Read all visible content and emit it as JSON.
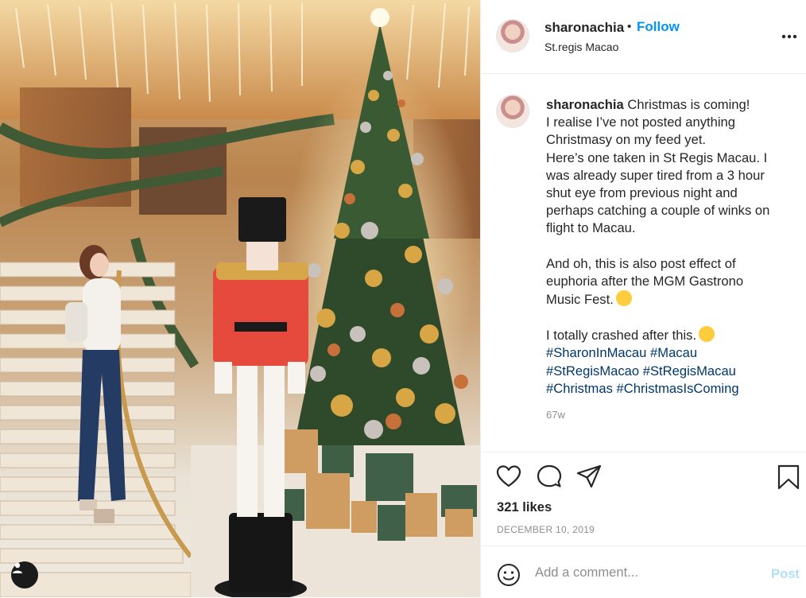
{
  "post": {
    "username": "sharonachia",
    "separator": "•",
    "follow_label": "Follow",
    "location": "St.regis Macao",
    "more_icon": "more-options-icon"
  },
  "caption": {
    "username": "sharonachia",
    "lines": [
      "Christmas is coming!",
      "I realise I’ve not posted anything",
      "Christmasy on my feed yet.",
      "Here’s one taken in St Regis Macau. I",
      "was already super tired from a 3 hour",
      "shut eye from previous night and",
      "perhaps catching a couple of winks on",
      "flight to Macau.",
      "And oh, this is also post effect of",
      "euphoria after the MGM Gastrono",
      "Music Fest.",
      "I totally crashed after this."
    ],
    "hashtags": [
      "#SharonInMacau",
      "#Macau",
      "#StRegisMacao",
      "#StRegisMacau",
      "#Christmas",
      "#ChristmasIsComing"
    ],
    "time_ago": "67w"
  },
  "actions": {
    "like_icon": "heart-icon",
    "comment_icon": "comment-icon",
    "share_icon": "share-icon",
    "save_icon": "bookmark-icon",
    "likes": "321 likes",
    "date": "DECEMBER 10, 2019"
  },
  "comment_box": {
    "emoji_icon": "smile-icon",
    "placeholder": "Add a comment...",
    "post_label": "Post"
  },
  "colors": {
    "link_blue": "#0095f6",
    "hashtag_blue": "#00376b",
    "muted": "#8e8e8e",
    "post_disabled": "#b2dffc"
  }
}
